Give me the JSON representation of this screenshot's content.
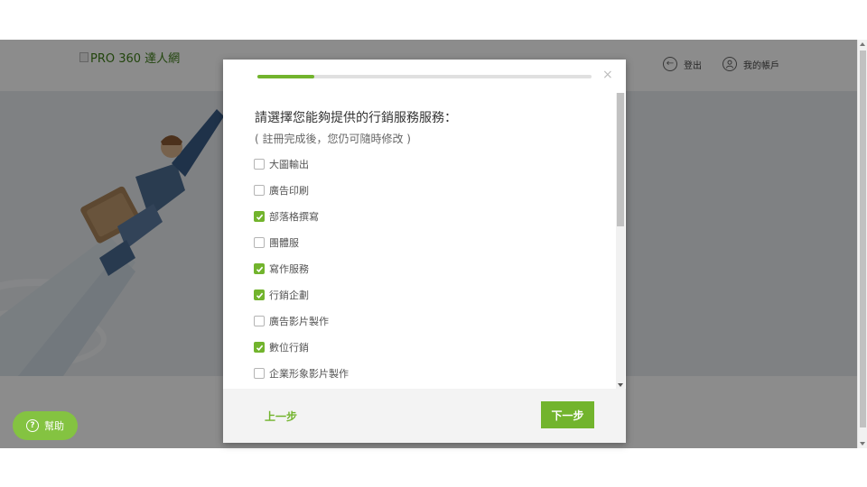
{
  "header": {
    "logo_text": "PRO 360 達人網",
    "login_label": "登出",
    "account_label": "我的帳戶"
  },
  "help": {
    "label": "幫助"
  },
  "modal": {
    "progress_fraction": 0.17,
    "close_symbol": "×",
    "question": "請選擇您能夠提供的行銷服務服務：",
    "hint": "( 註冊完成後，您仍可隨時修改 )",
    "options": [
      {
        "label": "大圖輸出",
        "checked": false
      },
      {
        "label": "廣告印刷",
        "checked": false
      },
      {
        "label": "部落格撰寫",
        "checked": true
      },
      {
        "label": "團體服",
        "checked": false
      },
      {
        "label": "寫作服務",
        "checked": true
      },
      {
        "label": "行銷企劃",
        "checked": true
      },
      {
        "label": "廣告影片製作",
        "checked": false
      },
      {
        "label": "數位行銷",
        "checked": true
      },
      {
        "label": "企業形象影片製作",
        "checked": false
      }
    ],
    "prev_label": "上一步",
    "next_label": "下一步"
  },
  "colors": {
    "brand_green": "#72b42d",
    "help_green": "#84c341",
    "overlay": "rgba(0,0,0,0.45)"
  },
  "icons": {
    "logout": "logout-arrow-icon",
    "account": "user-icon",
    "help": "question-circle-icon",
    "close": "close-icon",
    "check": "check-icon"
  }
}
